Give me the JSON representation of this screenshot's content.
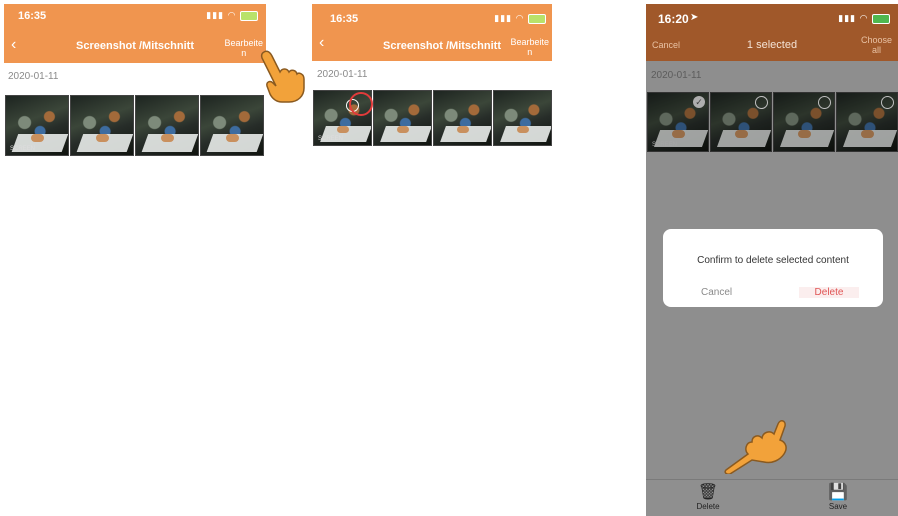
{
  "screen1": {
    "time": "16:35",
    "title": "Screenshot /Mitschnitt",
    "edit_label_line1": "Bearbeite",
    "edit_label_line2": "n",
    "date": "2020-01-11",
    "thumb_tag": "SCREEN"
  },
  "screen2": {
    "time": "16:35",
    "title": "Screenshot /Mitschnitt",
    "edit_label_line1": "Bearbeite",
    "edit_label_line2": "n",
    "date": "2020-01-11",
    "thumb_tag": "SCREEN"
  },
  "screen3": {
    "time": "16:20",
    "cancel_label": "Cancel",
    "selected_label": "1 selected",
    "choose_all_line1": "Choose",
    "choose_all_line2": "all",
    "date": "2020-01-11",
    "thumb_tag": "SCREEN",
    "dialog": {
      "message": "Confirm to delete selected content",
      "cancel_label": "Cancel",
      "delete_label": "Delete"
    },
    "toolbar": {
      "delete_label": "Delete",
      "save_label": "Save"
    }
  },
  "colors": {
    "accent": "#f0954f",
    "danger": "#e05555",
    "selection_ring": "#e23b3b"
  },
  "icons": [
    "back-chevron-icon",
    "signal-icon",
    "wifi-icon",
    "battery-icon",
    "pointing-hand-icon",
    "check-icon",
    "trash-icon",
    "save-icon"
  ]
}
